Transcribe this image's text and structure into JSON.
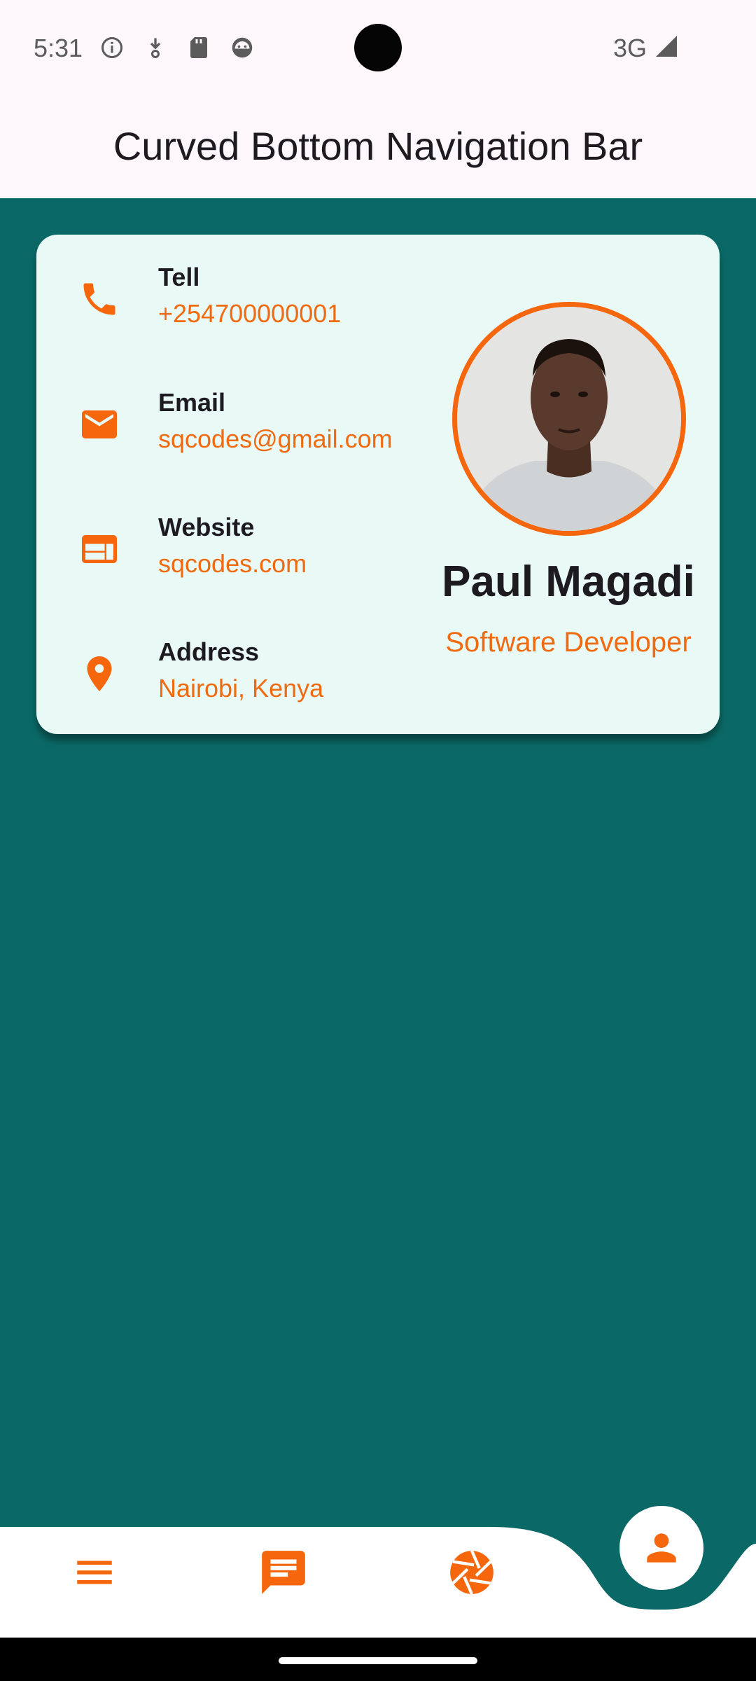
{
  "status_bar": {
    "time": "5:31",
    "network": "3G",
    "left_icons": [
      "info-icon",
      "download-icon",
      "sd-card-icon",
      "android-face-icon"
    ]
  },
  "app_bar": {
    "title": "Curved Bottom Navigation Bar"
  },
  "contact": {
    "items": [
      {
        "icon": "phone-icon",
        "label": "Tell",
        "value": "+254700000001"
      },
      {
        "icon": "email-icon",
        "label": "Email",
        "value": "sqcodes@gmail.com"
      },
      {
        "icon": "website-icon",
        "label": "Website",
        "value": "sqcodes.com"
      },
      {
        "icon": "location-icon",
        "label": "Address",
        "value": "Nairobi, Kenya"
      }
    ]
  },
  "profile": {
    "name": "Paul Magadi",
    "title": "Software Developer"
  },
  "bottom_nav": {
    "items": [
      {
        "icon": "menu-icon"
      },
      {
        "icon": "chat-icon"
      },
      {
        "icon": "camera-aperture-icon"
      },
      {
        "icon": "person-icon",
        "selected": true
      }
    ]
  },
  "colors": {
    "background": "#0a6966",
    "accent": "#f5660d",
    "card": "#e8f9f6",
    "bar": "#fdf7fb"
  }
}
